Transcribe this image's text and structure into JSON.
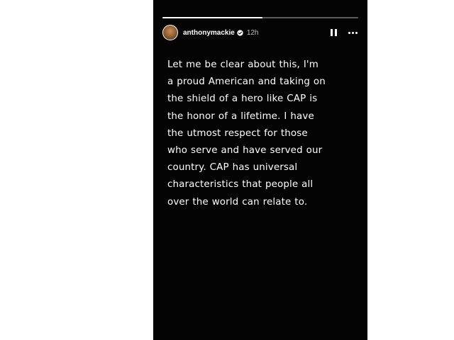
{
  "story": {
    "progress": 0.51,
    "author": {
      "username": "anthonymackie",
      "time_ago": "12h",
      "verified": true
    },
    "controls": {
      "pause_icon": "pause-icon",
      "more_icon": "more-options-icon"
    },
    "text_lines": [
      "Let me be clear about this, I'm",
      "a proud American and taking on",
      "the shield of a hero like CAP is",
      "the honor of a lifetime. I have",
      "the utmost respect for those",
      "who serve and have served our",
      "country. CAP has universal",
      "characteristics that people all",
      "over the world can relate to."
    ]
  },
  "colors": {
    "story_background": "#040404",
    "text": "#ffffff",
    "verified_badge": "#ffffff"
  }
}
